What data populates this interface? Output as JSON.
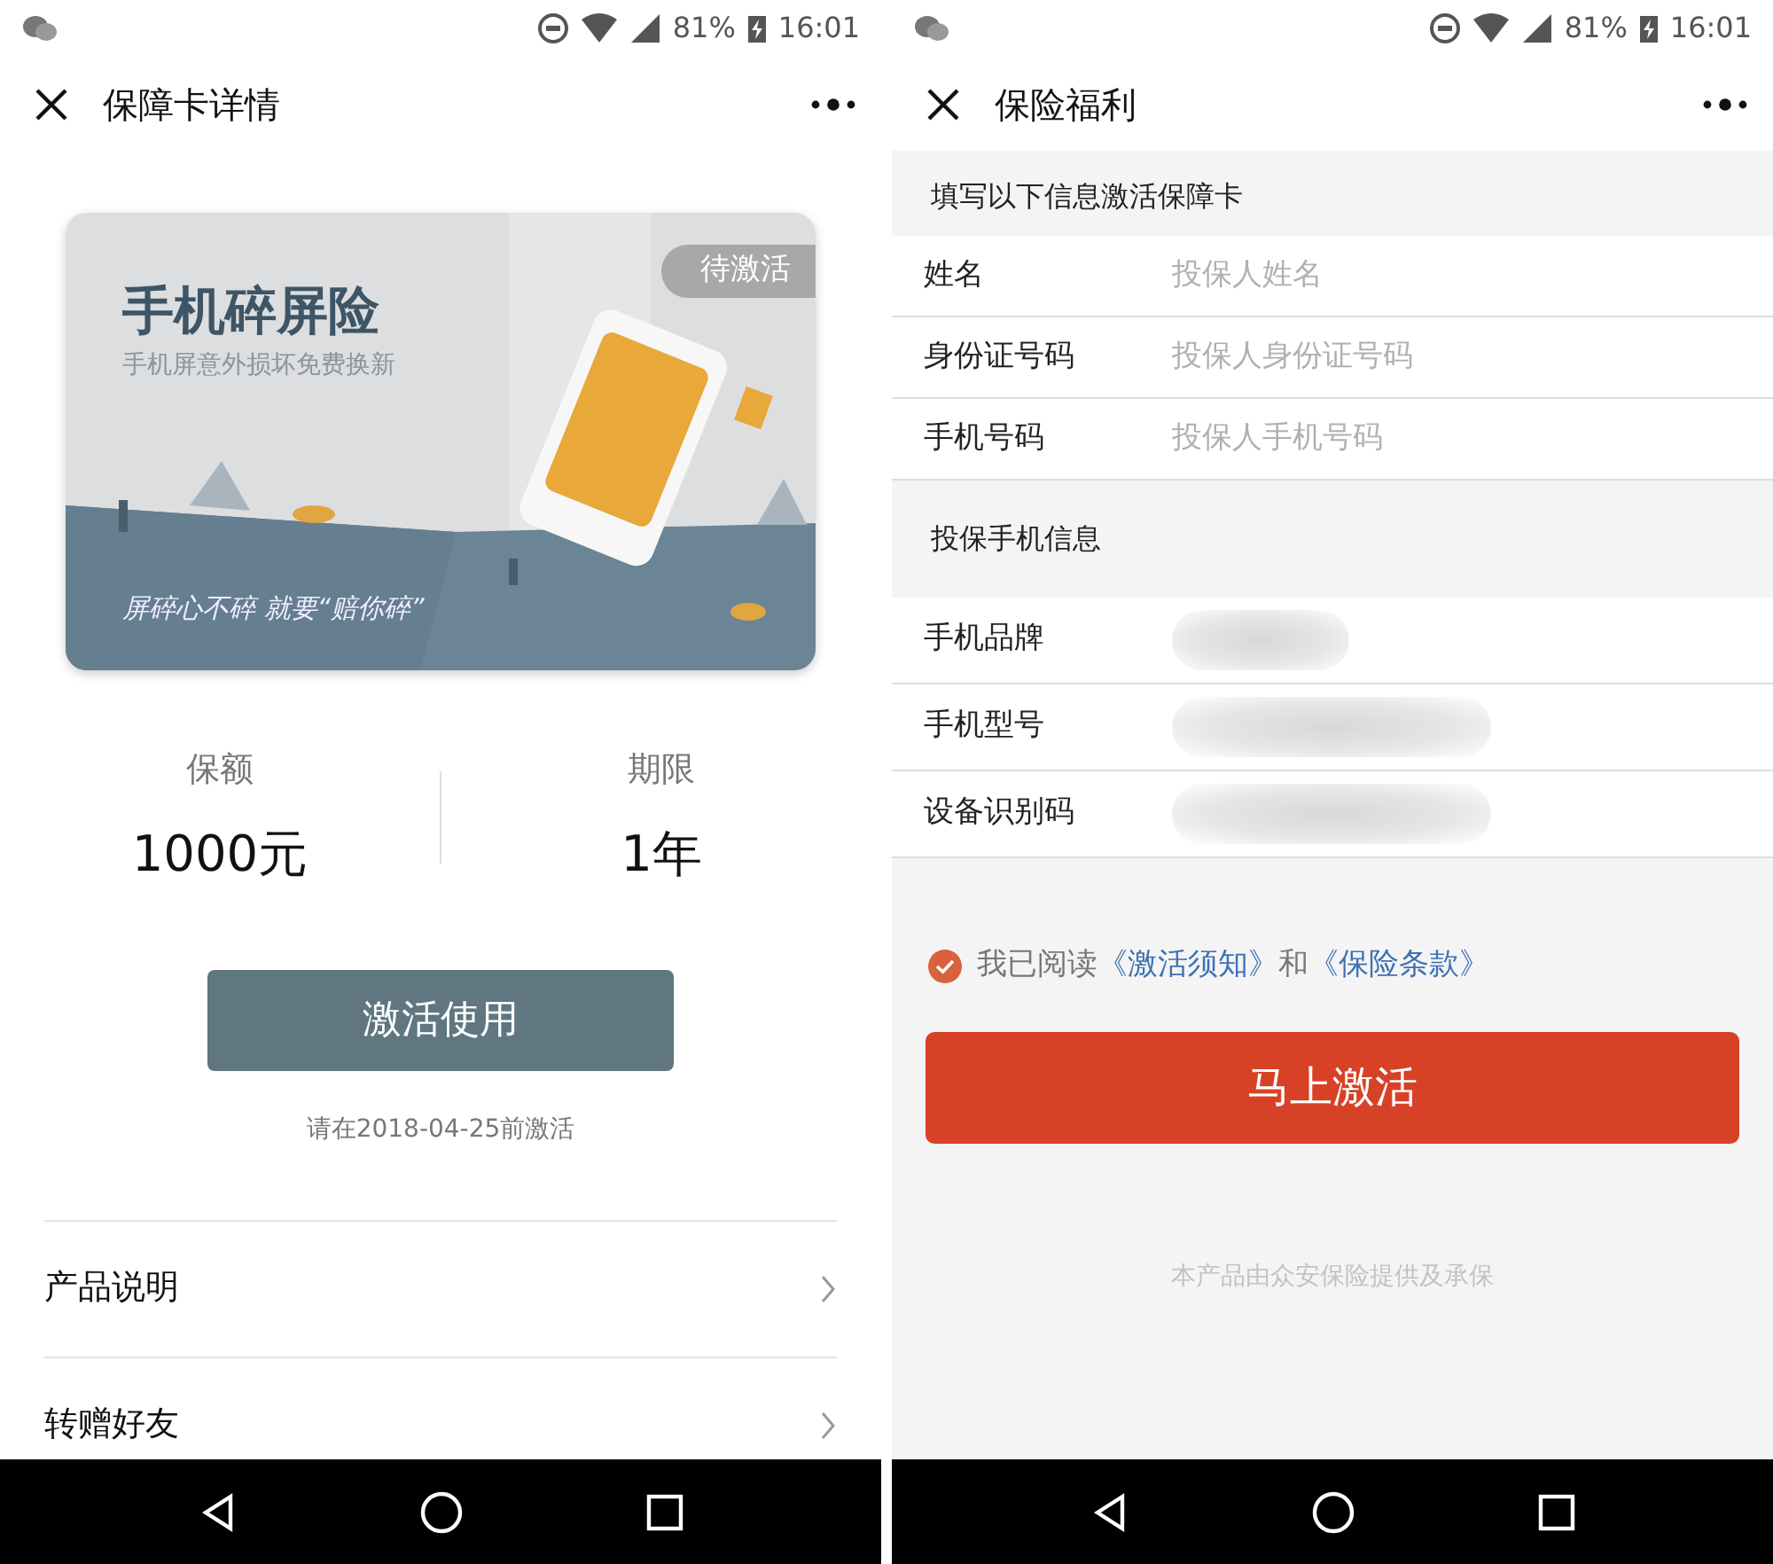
{
  "left_screen": {
    "status_bar": {
      "battery": "81%",
      "time": "16:01"
    },
    "title": "保障卡详情",
    "card": {
      "title": "手机碎屏险",
      "subtitle": "手机屏意外损坏免费换新",
      "slogan": "屏碎心不碎 就要“赔你碎”",
      "badge": "待激活"
    },
    "stats": [
      {
        "label": "保额",
        "value": "1000元"
      },
      {
        "label": "期限",
        "value": "1年"
      }
    ],
    "button": "激活使用",
    "hint": "请在2018-04-25前激活",
    "menu": [
      "产品说明",
      "转赠好友"
    ]
  },
  "right_screen": {
    "status_bar": {
      "battery": "81%",
      "time": "16:01"
    },
    "title": "保险福利",
    "sections": [
      {
        "header": "填写以下信息激活保障卡",
        "fields": [
          {
            "label": "姓名",
            "kind": "input",
            "placeholder": "投保人姓名"
          },
          {
            "label": "身份证号码",
            "kind": "input",
            "placeholder": "投保人身份证号码"
          },
          {
            "label": "手机号码",
            "kind": "input",
            "placeholder": "投保人手机号码"
          }
        ]
      },
      {
        "header": "投保手机信息",
        "fields": [
          {
            "label": "手机品牌",
            "kind": "blurred"
          },
          {
            "label": "手机型号",
            "kind": "blurred"
          },
          {
            "label": "设备识别码",
            "kind": "blurred"
          }
        ]
      }
    ],
    "agreement": {
      "checked": true,
      "parts": [
        {
          "kind": "text",
          "text": "我已阅读"
        },
        {
          "kind": "link",
          "text": "《激活须知》"
        },
        {
          "kind": "text",
          "text": "和"
        },
        {
          "kind": "link",
          "text": "《保险条款》"
        }
      ]
    },
    "button": "马上激活",
    "footer": "本产品由众安保险提供及承保"
  }
}
